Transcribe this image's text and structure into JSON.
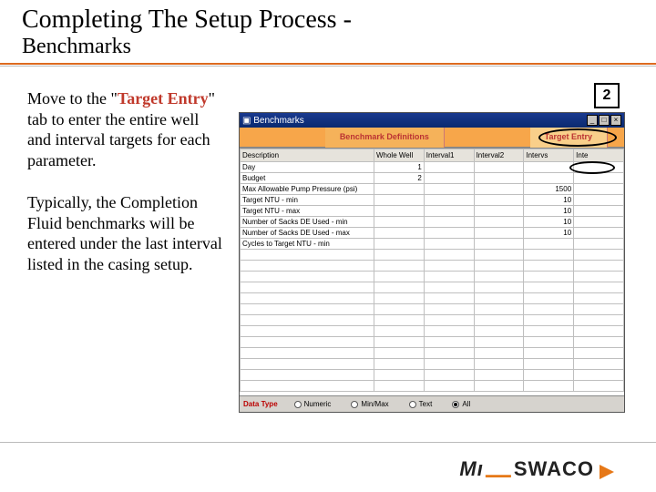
{
  "title": "Completing The Setup Process -",
  "subtitle": "Benchmarks",
  "step_number": "2",
  "body": {
    "p1_pre": " Move to the \"",
    "p1_accent": "Target Entry",
    "p1_post": "\" tab to enter the entire well and interval targets for each parameter.",
    "p2": "Typically, the Completion Fluid benchmarks will be entered under the last interval listed in the casing setup."
  },
  "window": {
    "title": "Benchmarks",
    "tabs": {
      "center": "Benchmark Definitions",
      "active": "Target Entry"
    },
    "columns": [
      "Description",
      "Whole Well",
      "Interval1",
      "Interval2",
      "Intervs",
      "Inte"
    ],
    "rows": [
      {
        "desc": "Day",
        "vals": [
          "1",
          "",
          "",
          "",
          ""
        ]
      },
      {
        "desc": "Budget",
        "vals": [
          "2",
          "",
          "",
          "",
          ""
        ]
      },
      {
        "desc": "Max Allowable Pump Pressure (psi)",
        "vals": [
          "",
          "",
          "",
          "1500",
          ""
        ]
      },
      {
        "desc": "Target NTU - min",
        "vals": [
          "",
          "",
          "",
          "10",
          ""
        ]
      },
      {
        "desc": "Target NTU - max",
        "vals": [
          "",
          "",
          "",
          "10",
          ""
        ]
      },
      {
        "desc": "Number of Sacks DE Used - min",
        "vals": [
          "",
          "",
          "",
          "10",
          ""
        ]
      },
      {
        "desc": "Number of Sacks DE Used - max",
        "vals": [
          "",
          "",
          "",
          "10",
          ""
        ]
      },
      {
        "desc": "Cycles to Target NTU - min",
        "vals": [
          "",
          "",
          "",
          "",
          ""
        ]
      }
    ],
    "bottom": {
      "label": "Data Type",
      "opts": [
        "Numeric",
        "Min/Max",
        "Text",
        "All"
      ],
      "selected": 3
    }
  },
  "logo": {
    "mi": "Mı",
    "dash": "—",
    "rest": "SWACO"
  }
}
